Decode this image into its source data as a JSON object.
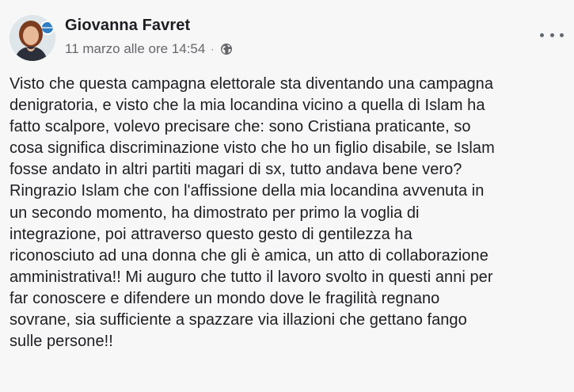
{
  "post": {
    "author": {
      "name": "Giovanna Favret"
    },
    "timestamp": "11 marzo alle ore 14:54",
    "separator": "·",
    "icons": {
      "audience": "globe-icon",
      "menu": "more-options-icon"
    },
    "text": "Visto che questa campagna elettorale sta diventando una campagna\ndenigratoria, e visto che la mia locandina vicino a quella di Islam ha\nfatto scalpore, volevo precisare che: sono Cristiana praticante, so\ncosa significa discriminazione visto che ho un figlio disabile, se Islam\nfosse andato in altri partiti magari di sx, tutto andava bene vero?\nRingrazio Islam che con l'affissione della mia locandina avvenuta in\nun secondo momento, ha dimostrato per primo la voglia di\nintegrazione, poi attraverso questo gesto di gentilezza ha\nriconosciuto ad una donna che gli è amica, un atto di collaborazione\namministrativa!! Mi auguro che tutto il lavoro svolto in questi anni per\nfar conoscere e difendere un mondo dove le fragilità regnano\nsovrane, sia sufficiente a spazzare via illazioni che gettano fango\nsulle persone!!"
  },
  "colors": {
    "background": "#f7f7f8",
    "text_primary": "#1c1e21",
    "text_secondary": "#65676b"
  }
}
